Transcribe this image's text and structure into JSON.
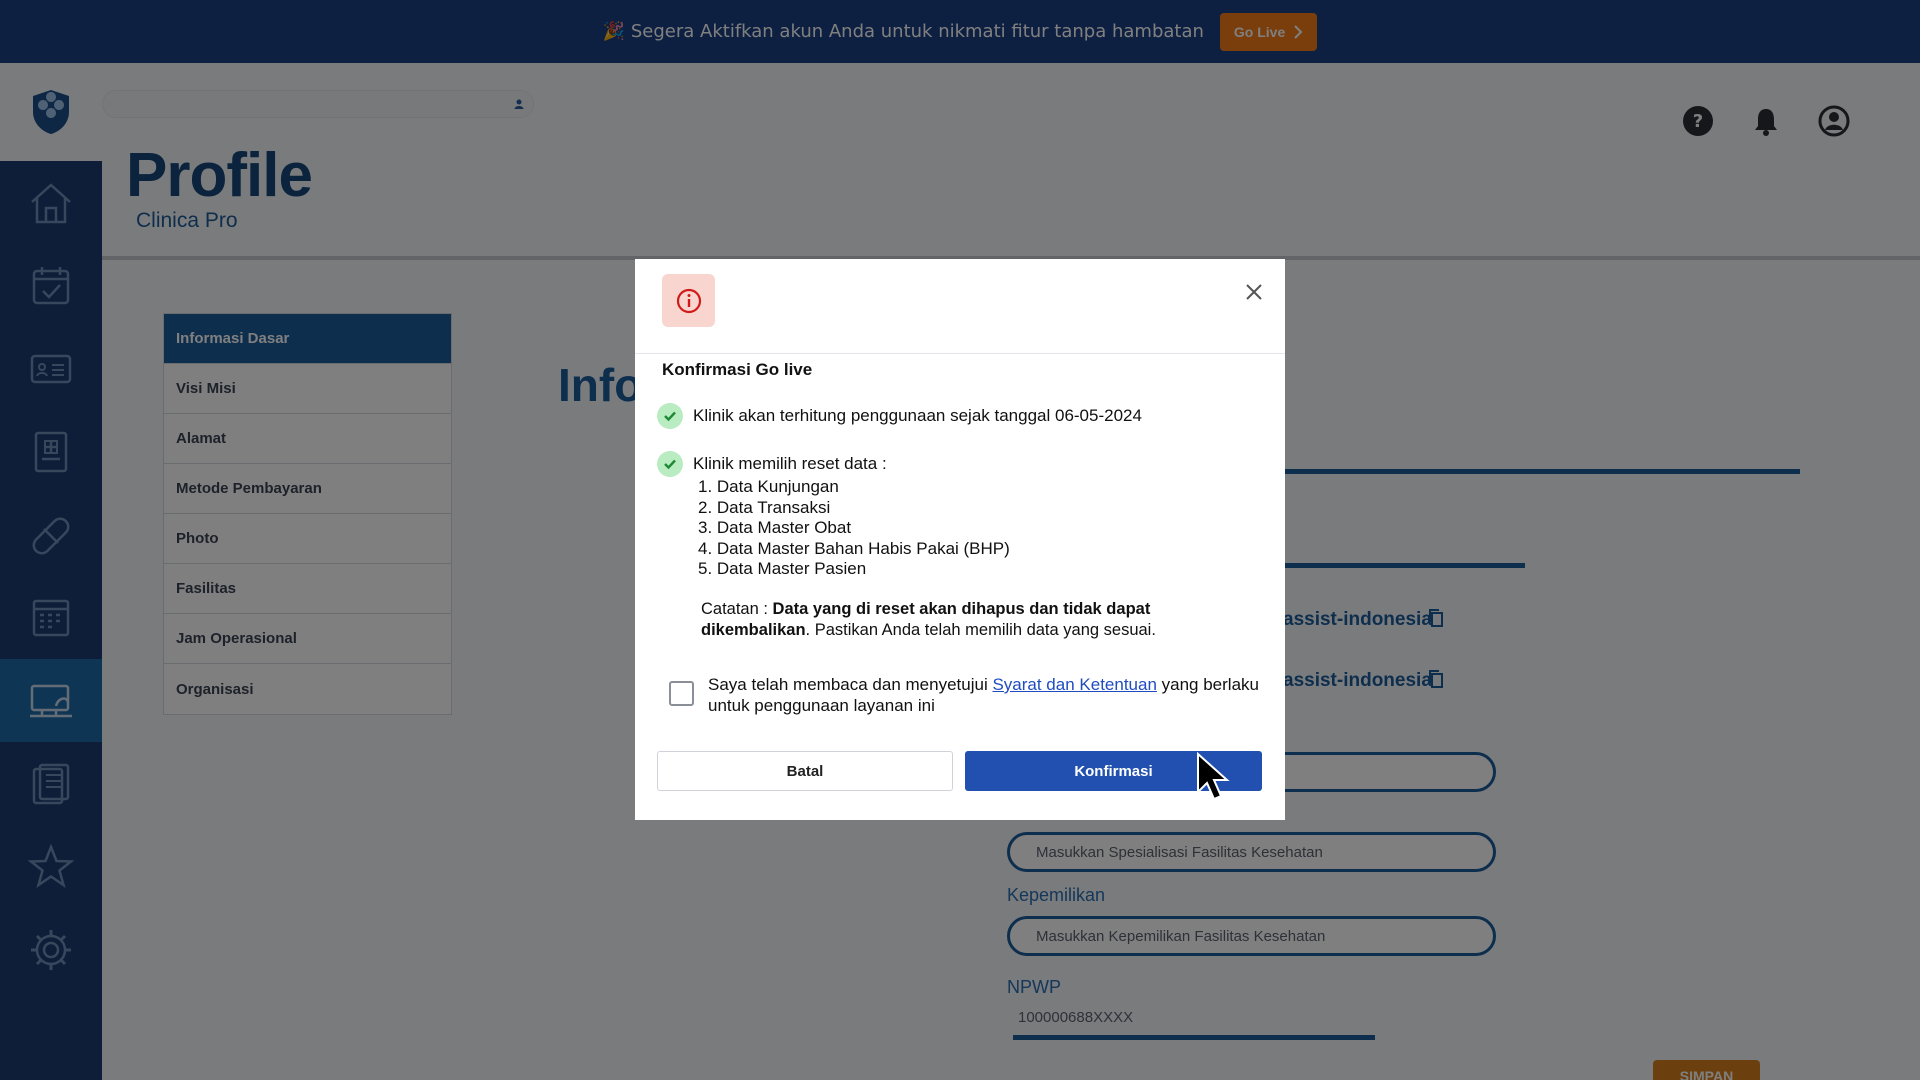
{
  "banner": {
    "emoji": "🎉",
    "text": "Segera Aktifkan akun Anda untuk nikmati fitur tanpa hambatan",
    "go_live_label": "Go Live",
    "colors": {
      "background": "#1b4085",
      "button": "#f27c16"
    }
  },
  "sidebar": {
    "items": [
      {
        "icon": "home-icon"
      },
      {
        "icon": "calendar-check-icon"
      },
      {
        "icon": "id-card-icon"
      },
      {
        "icon": "medical-record-icon"
      },
      {
        "icon": "pill-icon"
      },
      {
        "icon": "schedule-icon"
      },
      {
        "icon": "computer-settings-icon",
        "active": true
      },
      {
        "icon": "clipboard-icon"
      },
      {
        "icon": "star-icon"
      },
      {
        "icon": "gear-icon"
      }
    ]
  },
  "header": {
    "title": "Profile",
    "subtitle": "Clinica Pro",
    "icons": [
      "help-icon",
      "bell-icon",
      "user-icon"
    ]
  },
  "profile_menu": {
    "items": [
      {
        "label": "Informasi Dasar",
        "active": true
      },
      {
        "label": "Visi Misi"
      },
      {
        "label": "Alamat"
      },
      {
        "label": "Metode Pembayaran"
      },
      {
        "label": "Photo"
      },
      {
        "label": "Fasilitas"
      },
      {
        "label": "Jam Operasional"
      },
      {
        "label": "Organisasi"
      }
    ]
  },
  "main": {
    "heading_fragment": "Info",
    "link_fragment_1": "assist-indonesia",
    "link_fragment_2": "assist-indonesia",
    "specialization_placeholder": "Masukkan Spesialisasi Fasilitas Kesehatan",
    "ownership_label": "Kepemilikan",
    "ownership_placeholder": "Masukkan Kepemilikan Fasilitas Kesehatan",
    "npwp_label": "NPWP",
    "npwp_value": "100000688XXXX",
    "save_label": "SIMPAN"
  },
  "modal": {
    "title": "Konfirmasi Go live",
    "check_1": "Klinik akan terhitung penggunaan sejak tanggal 06-05-2024",
    "check_2": "Klinik memilih reset data :",
    "reset_items": [
      "1. Data Kunjungan",
      "2. Data Transaksi",
      "3. Data Master Obat",
      "4. Data Master Bahan Habis Pakai (BHP)",
      "5. Data Master Pasien"
    ],
    "note_prefix": "Catatan : ",
    "note_bold": "Data yang di reset akan dihapus dan tidak dapat dikembalikan",
    "note_suffix": ". Pastikan Anda telah memilih data yang sesuai.",
    "agree_prefix": "Saya telah membaca dan menyetujui ",
    "agree_link": "Syarat dan Ketentuan",
    "agree_suffix": " yang berlaku untuk penggunaan layanan ini",
    "cancel_label": "Batal",
    "confirm_label": "Konfirmasi",
    "colors": {
      "confirm": "#2150b0",
      "check": "#b9ecc0",
      "info_badge": "#f9d5cf"
    }
  }
}
